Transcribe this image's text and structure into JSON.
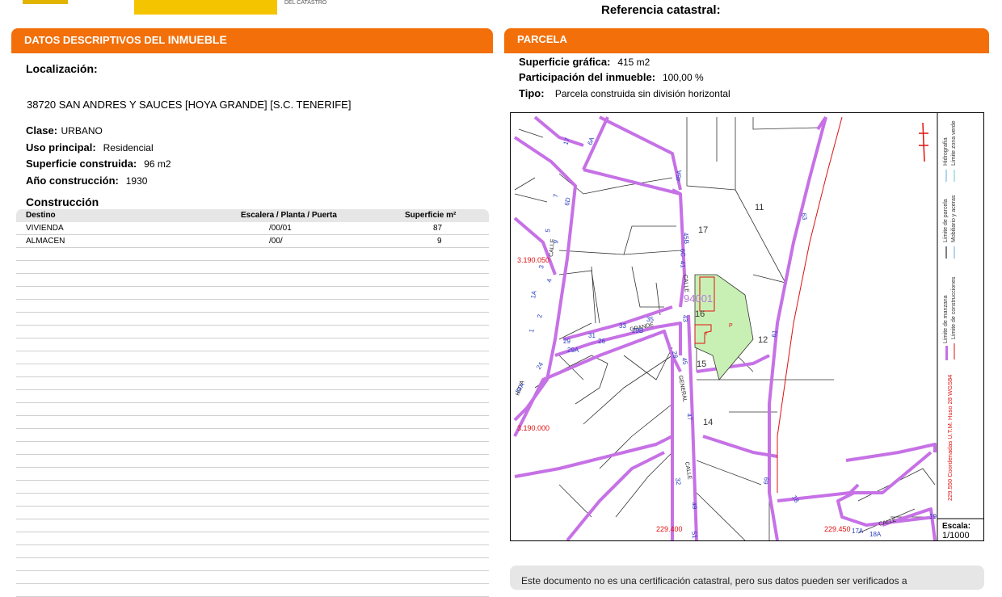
{
  "header": {
    "logo_subtext": "DEL CATASTRO",
    "reference_title": "Referencia catastral:"
  },
  "left_section": {
    "title_prefix": "DATOS DESCRIPTIVOS DEL ",
    "title_emph": "INMUEBLE",
    "localizacion_label": "Localización:",
    "address": "38720 SAN ANDRES Y SAUCES [HOYA GRANDE] [S.C. TENERIFE]",
    "fields": [
      {
        "label": "Clase:",
        "value": "URBANO"
      },
      {
        "label": "Uso principal:",
        "value": "Residencial"
      },
      {
        "label": "Superficie construida:",
        "value": "96 m2"
      },
      {
        "label": "Año construcción:",
        "value": "1930"
      }
    ],
    "construccion_title": "Construcción",
    "table": {
      "headers": [
        "Destino",
        "Escalera / Planta / Puerta",
        "Superficie m²"
      ],
      "rows": [
        [
          "VIVIENDA",
          "/00/01",
          "87"
        ],
        [
          "ALMACEN",
          "/00/",
          "9"
        ]
      ]
    }
  },
  "right_section": {
    "title": "PARCELA",
    "fields": [
      {
        "label": "Superficie gráfica:",
        "value": "415 m2"
      },
      {
        "label": "Participación del inmueble:",
        "value": "100,00 %"
      },
      {
        "label": "Tipo:",
        "value": "Parcela construida sin división horizontal"
      }
    ]
  },
  "map": {
    "parcel_id": "94001",
    "labels": {
      "block_11": "11",
      "block_17": "17",
      "block_16": "16",
      "block_15": "15",
      "block_12": "12",
      "block_14": "14",
      "p_mark": "P",
      "i_mark": "I",
      "street_grande": "GRANDE",
      "street_hoya": "HOYA",
      "street_general": "GENERAL",
      "street_calle_a": "CALLE",
      "street_calle_b": "CALLE",
      "street_calle_c": "CALLE",
      "coord_y_top": "3.190.050",
      "coord_y_bottom": "3.190.000",
      "coord_x_left": "229.400",
      "coord_x_right": "229.450",
      "num_17": "17",
      "num_6A": "6A",
      "num_45A": "45A",
      "num_7": "7",
      "num_6D": "6D",
      "num_5": "5",
      "num_9": "9",
      "num_3": "3",
      "num_4": "4",
      "num_45B": "45B",
      "num_6C": "6C",
      "num_41": "41",
      "num_43": "43",
      "num_1A": "1A",
      "num_2": "2",
      "num_1": "1",
      "num_29": "29",
      "num_31": "31",
      "num_33": "33",
      "num_35": "35",
      "num_29A": "29A",
      "num_29B": "29B",
      "num_26": "26",
      "num_28": "28",
      "num_45": "45",
      "num_24": "24",
      "num_24A": "24A",
      "num_47": "47",
      "num_32": "32",
      "num_49": "49",
      "num_51": "51",
      "num_63": "63",
      "num_61": "61",
      "num_69": "69",
      "num_18": "18",
      "num_17A": "17A",
      "num_18A": "18A",
      "num_19": "19"
    },
    "legend": {
      "items": [
        "Límite de manzana",
        "Límite de parcela",
        "Hidrografía",
        "Límite de construcciones",
        "Mobiliario y aceras",
        "Límite zona verde"
      ],
      "coords": "229.550 Coordenadas U.T.M. Huso 28 WGS84",
      "scale_label": "Escala:",
      "scale_value": "1/1000"
    }
  },
  "footer_note": "Este documento no es una certificación catastral, pero sus datos pueden ser verificados a",
  "colors": {
    "accent_orange": "#f26f0a",
    "block_purple": "#c671e6",
    "parcel_green": "#c9f0b4",
    "coord_red": "#e01010",
    "number_blue": "#2a3fbf"
  }
}
